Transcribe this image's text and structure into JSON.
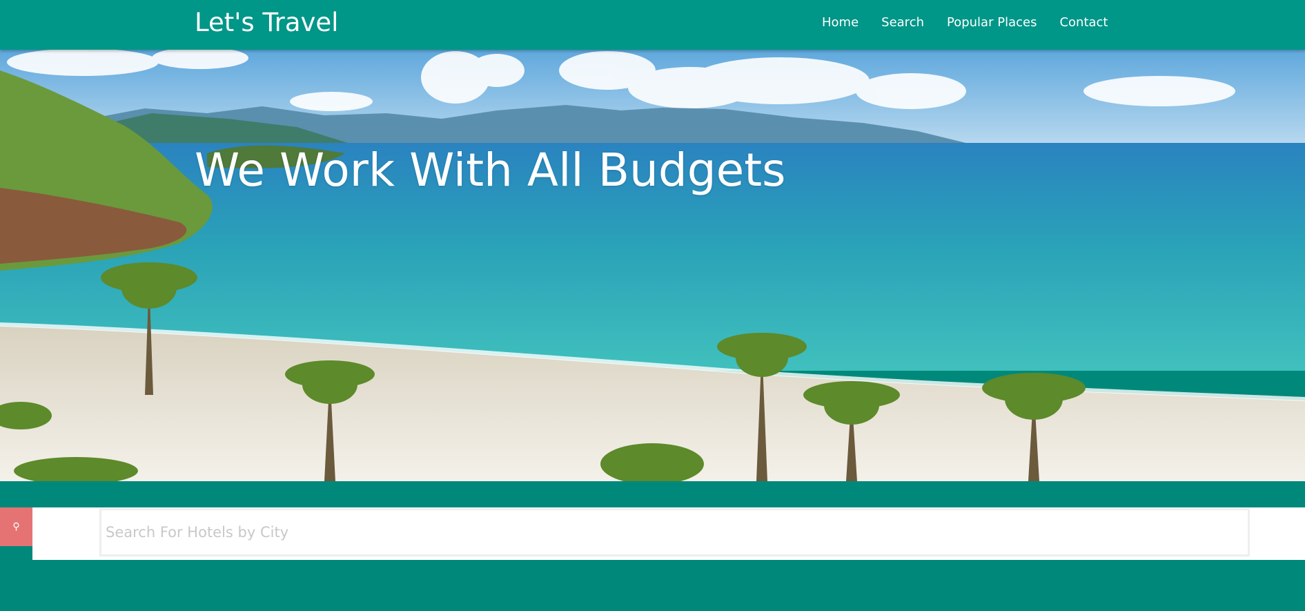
{
  "header": {
    "brand": "Let's Travel",
    "nav": [
      "Home",
      "Search",
      "Popular Places",
      "Contact"
    ]
  },
  "hero": {
    "title": "We Work With All Budgets",
    "image": "tropical-beach-with-palm-trees"
  },
  "search": {
    "placeholder": "Search For Hotels by City",
    "value": "",
    "icon": "map-pin-icon"
  },
  "colors": {
    "header": "#009688",
    "page": "#00897b",
    "accent": "#e57373"
  }
}
